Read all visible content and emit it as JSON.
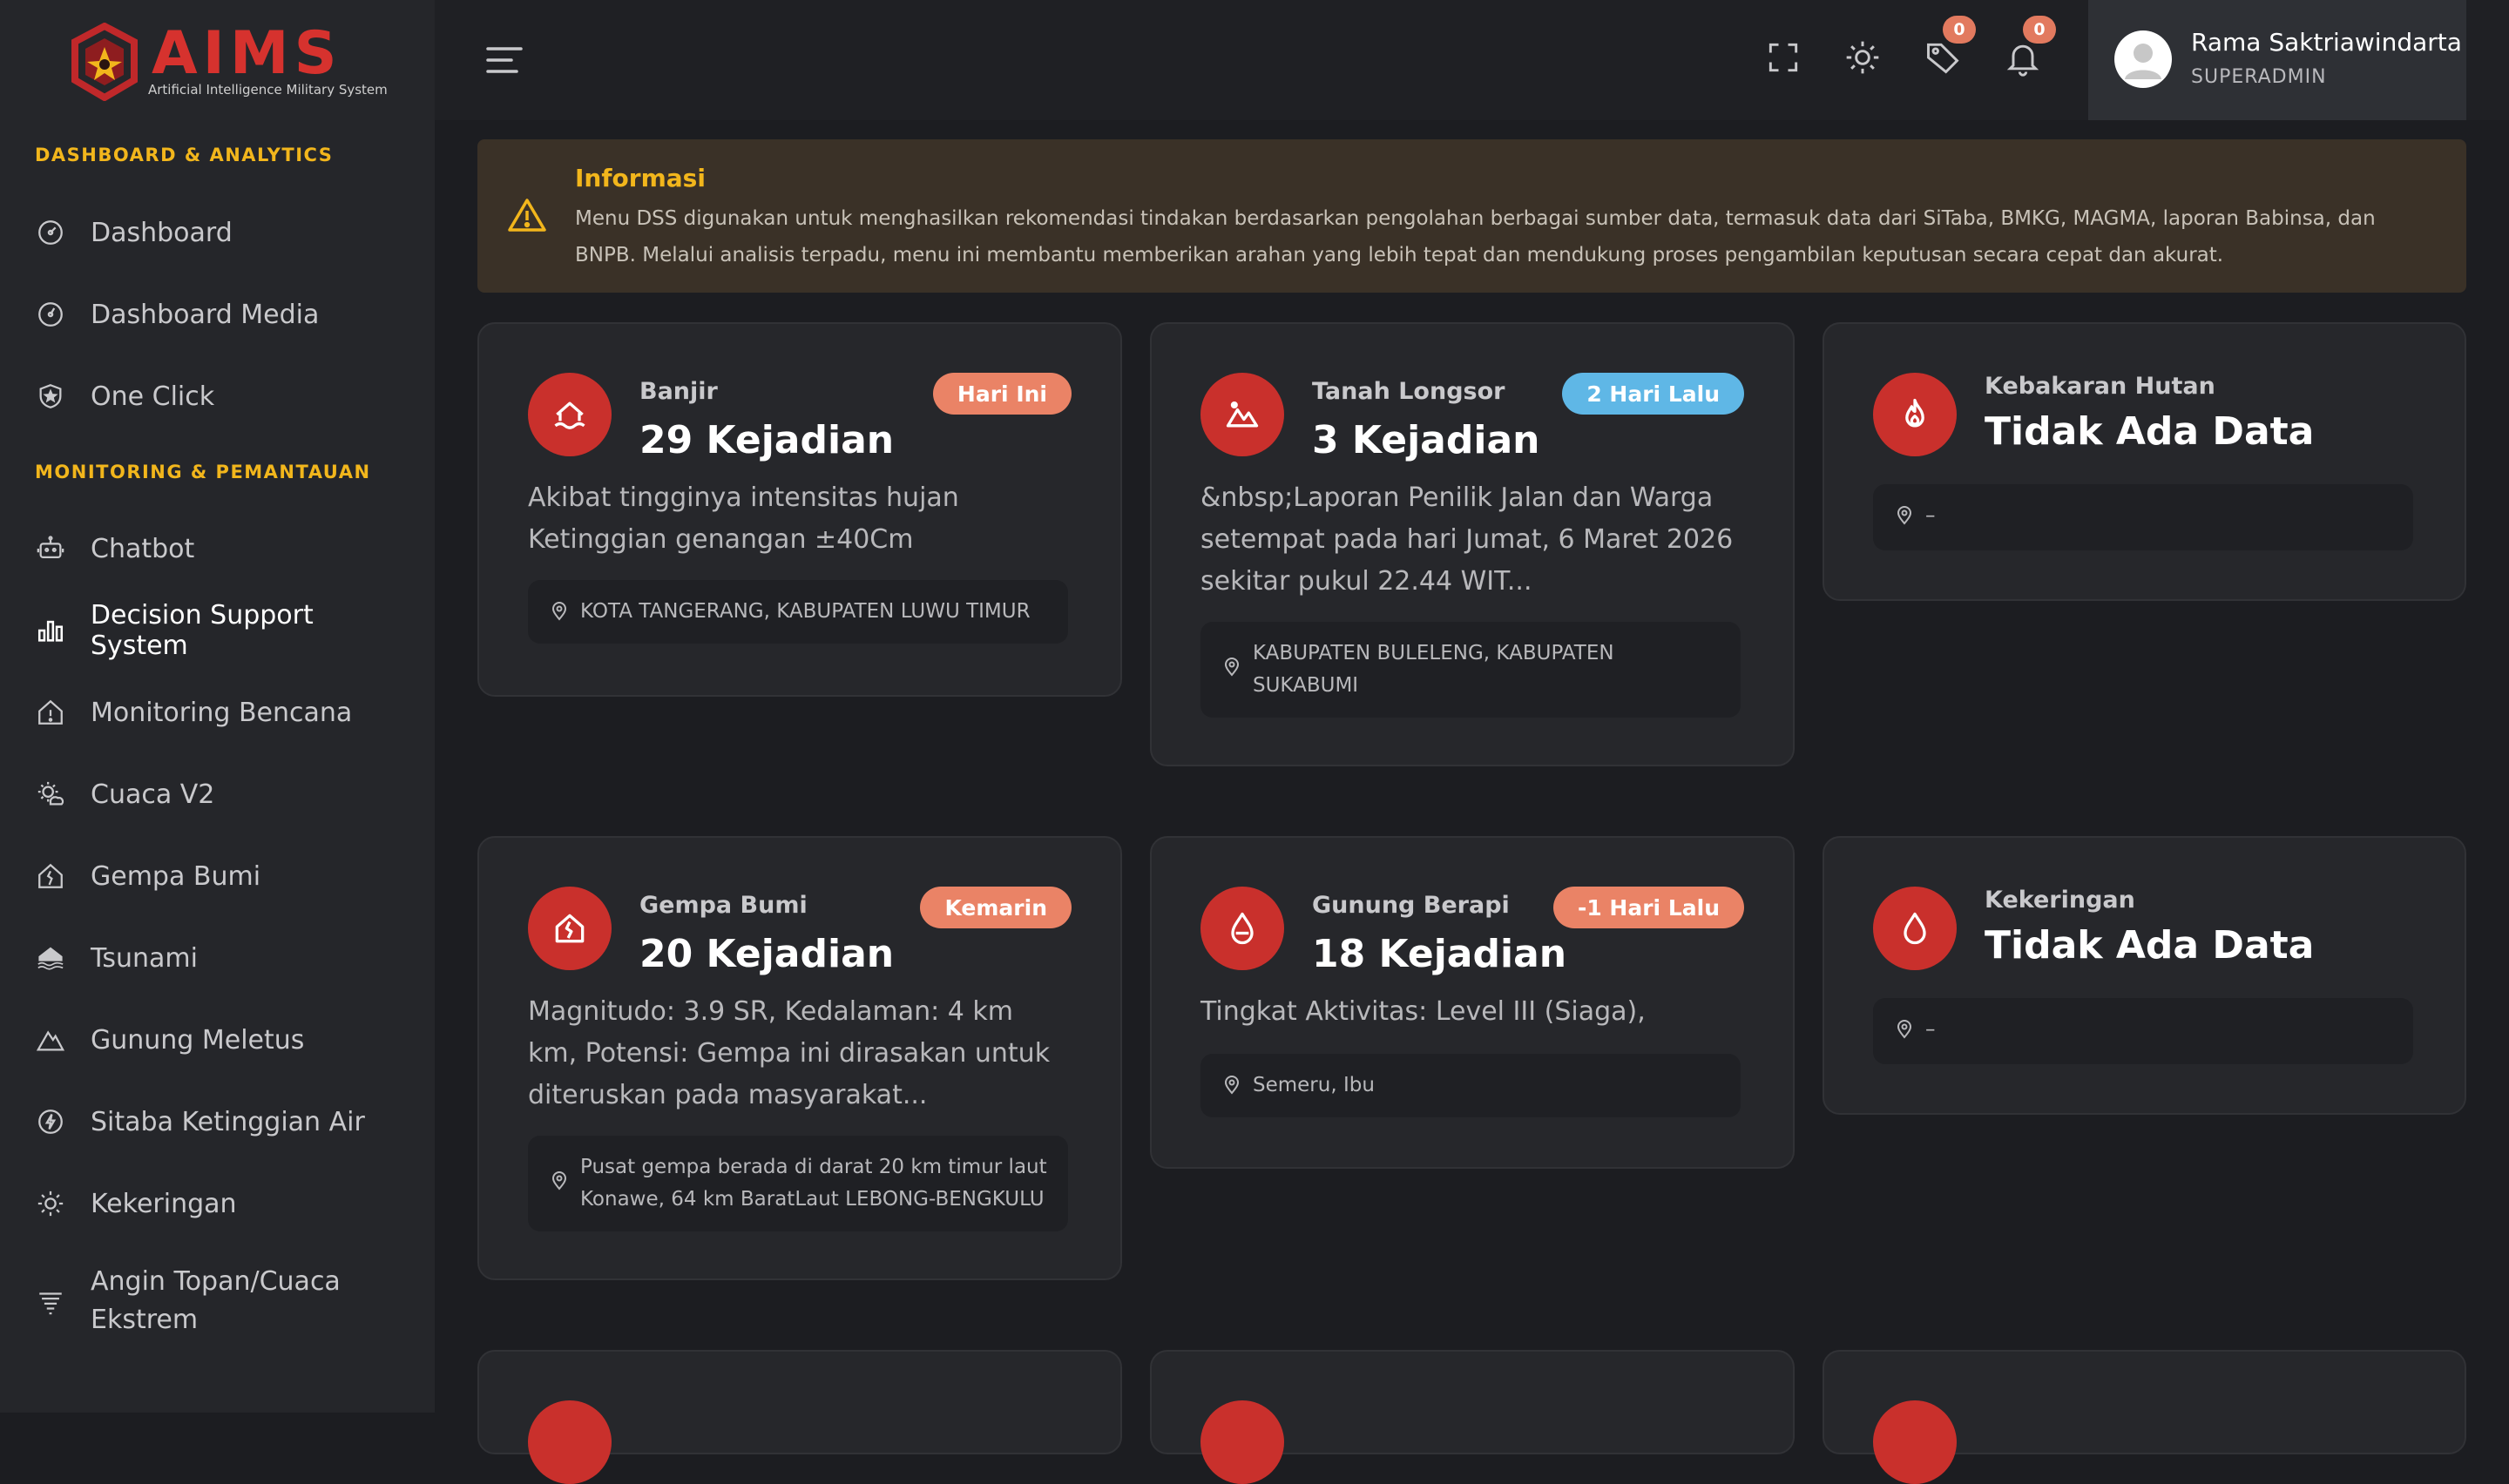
{
  "brand": {
    "name": "AIMS",
    "tagline": "Artificial Intelligence Military System",
    "color": "#d6322e"
  },
  "sidebar": {
    "sections": [
      {
        "label": "DASHBOARD & ANALYTICS"
      },
      {
        "label": "MONITORING & PEMANTAUAN"
      }
    ],
    "items": [
      {
        "label": "Dashboard",
        "icon": "gauge-icon"
      },
      {
        "label": "Dashboard Media",
        "icon": "gauge-icon"
      },
      {
        "label": "One Click",
        "icon": "shield-star-icon"
      },
      {
        "label": "Chatbot",
        "icon": "robot-icon"
      },
      {
        "label": "Decision Support System",
        "icon": "bar-chart-icon",
        "active": true
      },
      {
        "label": "Monitoring Bencana",
        "icon": "house-alert-icon"
      },
      {
        "label": "Cuaca V2",
        "icon": "sun-cloud-icon"
      },
      {
        "label": "Gempa Bumi",
        "icon": "house-crack-icon"
      },
      {
        "label": "Tsunami",
        "icon": "wave-house-icon"
      },
      {
        "label": "Gunung Meletus",
        "icon": "mountain-icon"
      },
      {
        "label": "Sitaba Ketinggian Air",
        "icon": "water-level-icon"
      },
      {
        "label": "Kekeringan",
        "icon": "sun-icon"
      },
      {
        "label": "Angin Topan/Cuaca Ekstrem",
        "icon": "wind-icon"
      }
    ]
  },
  "header": {
    "tag_count": "0",
    "notification_count": "0",
    "user": {
      "name": "Rama Saktriawindarta",
      "role": "SUPERADMIN"
    }
  },
  "info": {
    "title": "Informasi",
    "text": "Menu DSS digunakan untuk menghasilkan rekomendasi tindakan berdasarkan pengolahan berbagai sumber data, termasuk data dari SiTaba, BMKG, MAGMA, laporan Babinsa, dan BNPB. Melalui analisis terpadu, menu ini membantu memberikan arahan yang lebih tepat dan mendukung proses pengambilan keputusan secara cepat dan akurat."
  },
  "cards": [
    {
      "category": "Banjir",
      "count": "29 Kejadian",
      "badge": "Hari Ini",
      "description": "Akibat tingginya intensitas hujan Ketinggian genangan ±40Cm",
      "location": "KOTA TANGERANG, KABUPATEN LUWU TIMUR"
    },
    {
      "category": "Tanah Longsor",
      "count": "3 Kejadian",
      "badge": "2 Hari Lalu",
      "description": "&nbsp;Laporan Penilik Jalan dan Warga setempat pada hari Jumat, 6 Maret 2026 sekitar pukul 22.44 WIT...",
      "location": "KABUPATEN BULELENG, KABUPATEN SUKABUMI"
    },
    {
      "category": "Kebakaran Hutan",
      "count": "Tidak Ada Data",
      "location": "–"
    },
    {
      "category": "Gempa Bumi",
      "count": "20 Kejadian",
      "badge": "Kemarin",
      "description": "Magnitudo: 3.9 SR, Kedalaman: 4 km km, Potensi: Gempa ini dirasakan untuk diteruskan pada masyarakat...",
      "location": "Pusat gempa berada di darat 20 km timur laut Konawe, 64 km BaratLaut LEBONG-BENGKULU"
    },
    {
      "category": "Gunung Berapi",
      "count": "18 Kejadian",
      "badge": "-1 Hari Lalu",
      "description": "Tingkat Aktivitas: Level III (Siaga),",
      "location": "Semeru, Ibu"
    },
    {
      "category": "Kekeringan",
      "count": "Tidak Ada Data",
      "location": "–"
    }
  ],
  "colors": {
    "accent_yellow": "#f2b61c",
    "icon_red": "#c9302c",
    "badge_orange": "#ea8366",
    "badge_blue": "#5fb7e6"
  }
}
